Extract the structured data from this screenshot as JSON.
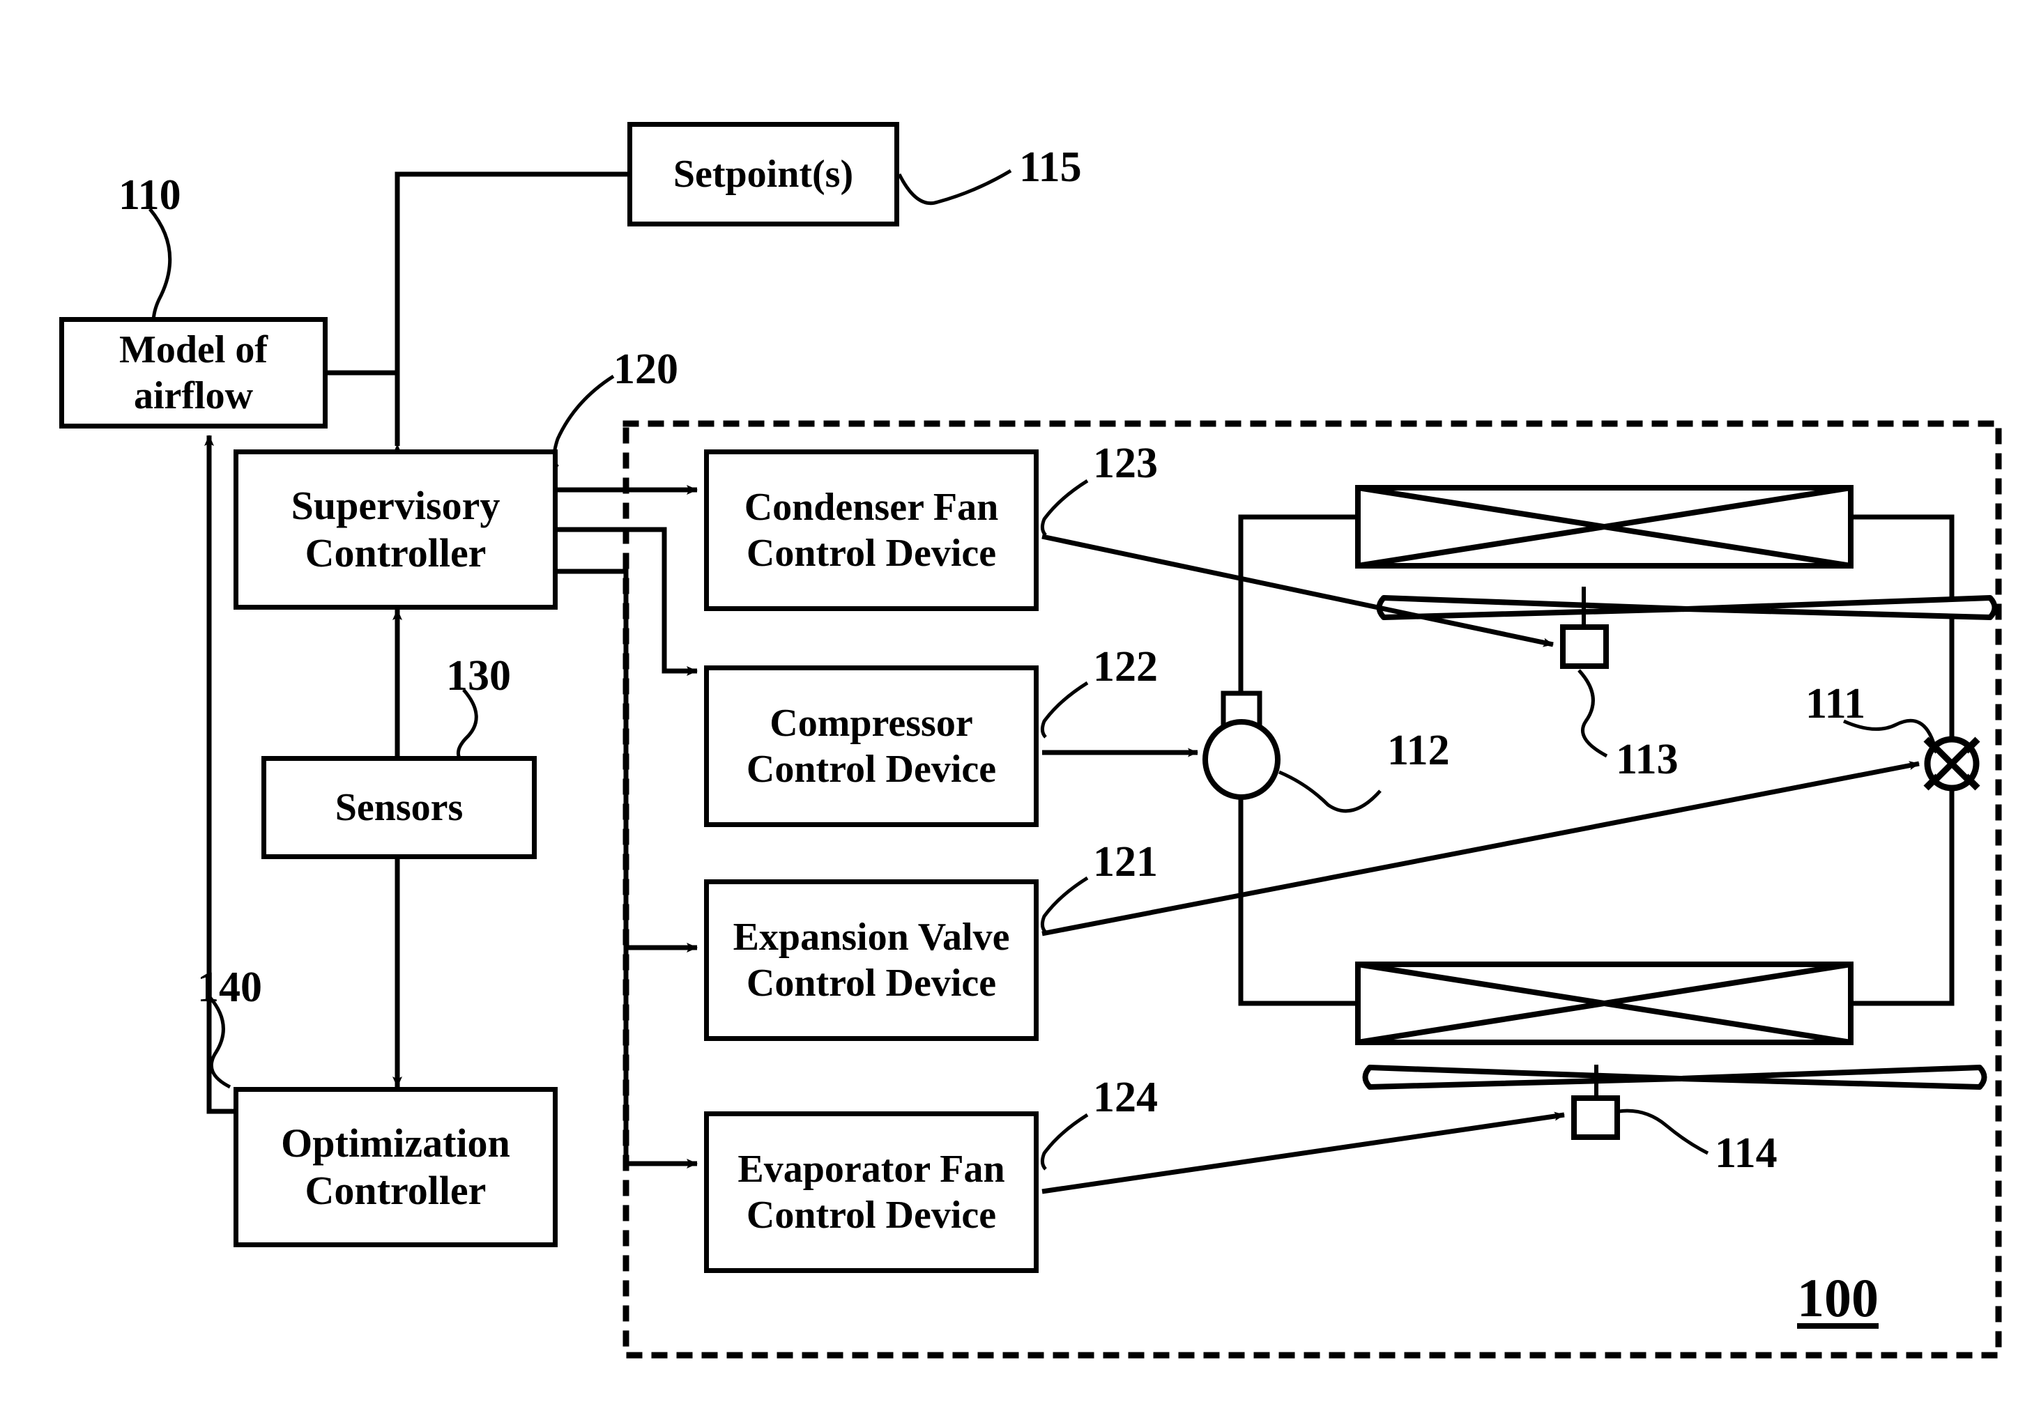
{
  "figure": {
    "system_label": "100",
    "title_hidden": ""
  },
  "blocks": {
    "setpoints": {
      "label": "Setpoint(s)",
      "ref": "115"
    },
    "model_of_airflow": {
      "label": "Model of\nairflow",
      "ref": "110"
    },
    "supervisory_controller": {
      "label": "Supervisory\nController",
      "ref": "120"
    },
    "sensors": {
      "label": "Sensors",
      "ref": "130"
    },
    "optimization_controller": {
      "label": "Optimization\nController",
      "ref": "140"
    },
    "condenser_fan_control_device": {
      "label": "Condenser Fan\nControl Device",
      "ref": "123"
    },
    "compressor_control_device": {
      "label": "Compressor\nControl Device",
      "ref": "122"
    },
    "expansion_valve_control_device": {
      "label": "Expansion Valve\nControl Device",
      "ref": "121"
    },
    "evaporator_fan_control_device": {
      "label": "Evaporator Fan\nControl Device",
      "ref": "124"
    }
  },
  "components": {
    "expansion_valve": {
      "ref": "111",
      "name": "expansion-valve"
    },
    "compressor": {
      "ref": "112",
      "name": "compressor"
    },
    "condenser_fan_motor": {
      "ref": "113",
      "name": "condenser-fan-motor"
    },
    "evaporator_fan_motor": {
      "ref": "114",
      "name": "evaporator-fan-motor"
    },
    "condenser_heat_exchanger": {
      "name": "condenser-heat-exchanger"
    },
    "evaporator_heat_exchanger": {
      "name": "evaporator-heat-exchanger"
    },
    "condenser_fan_blade": {
      "name": "condenser-fan-blade"
    },
    "evaporator_fan_blade": {
      "name": "evaporator-fan-blade"
    }
  },
  "refs": {
    "r110": "110",
    "r115": "115",
    "r120": "120",
    "r121": "121",
    "r122": "122",
    "r123": "123",
    "r124": "124",
    "r130": "130",
    "r140": "140",
    "r111": "111",
    "r112": "112",
    "r113": "113",
    "r114": "114",
    "r100": "100"
  },
  "colors": {
    "stroke": "#000000",
    "background": "#ffffff"
  },
  "labels": {
    "setpoints": "Setpoint(s)",
    "model_line1": "Model of",
    "model_line2": "airflow",
    "supervisory_line1": "Supervisory",
    "supervisory_line2": "Controller",
    "sensors": "Sensors",
    "optimization_line1": "Optimization",
    "optimization_line2": "Controller",
    "condfan_line1": "Condenser Fan",
    "condfan_line2": "Control Device",
    "compressor_line1": "Compressor",
    "compressor_line2": "Control Device",
    "expvalve_line1": "Expansion Valve",
    "expvalve_line2": "Control Device",
    "evapfan_line1": "Evaporator Fan",
    "evapfan_line2": "Control Device"
  }
}
